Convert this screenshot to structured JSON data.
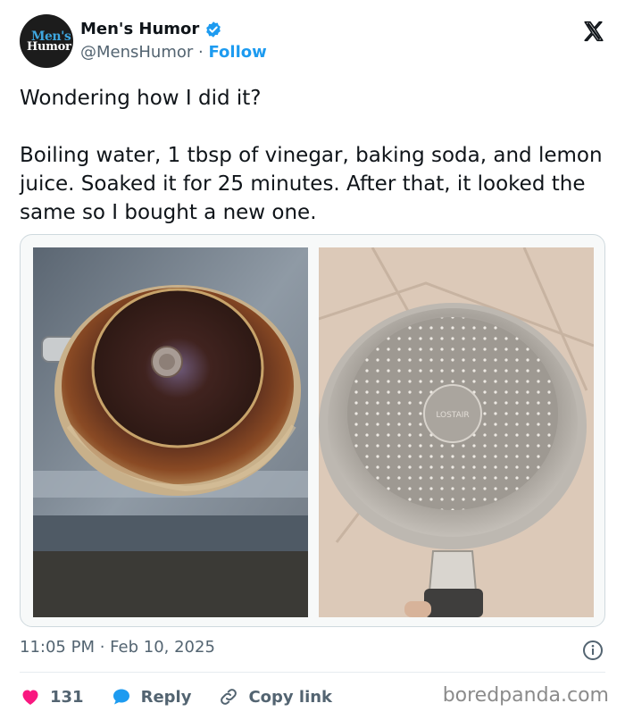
{
  "author": {
    "display_name": "Men's Humor",
    "handle": "@MensHumor",
    "separator": "·",
    "follow_label": "Follow",
    "avatar_line1": "Men's",
    "avatar_line2": "Humor",
    "verified_icon": "verified-badge-icon",
    "verified_color": "#1d9bf0"
  },
  "platform_icon": "x-logo-icon",
  "tweet": {
    "text": "Wondering how I did it?\n\nBoiling water, 1 tbsp of vinegar, baking soda, and lemon juice. Soaked it for 25 minutes. After that, it looked the same so I bought a new one."
  },
  "media": {
    "images": [
      {
        "name": "burnt-pan-photo"
      },
      {
        "name": "new-pan-photo",
        "stamp_text": "LOSTAIR"
      }
    ]
  },
  "meta": {
    "time": "11:05 PM",
    "separator": " · ",
    "date": "Feb 10, 2025"
  },
  "actions": {
    "likes_count": "131",
    "reply_label": "Reply",
    "copy_link_label": "Copy link",
    "heart_color": "#f91880",
    "reply_color": "#1d9bf0"
  },
  "watermark": "boredpanda.com"
}
